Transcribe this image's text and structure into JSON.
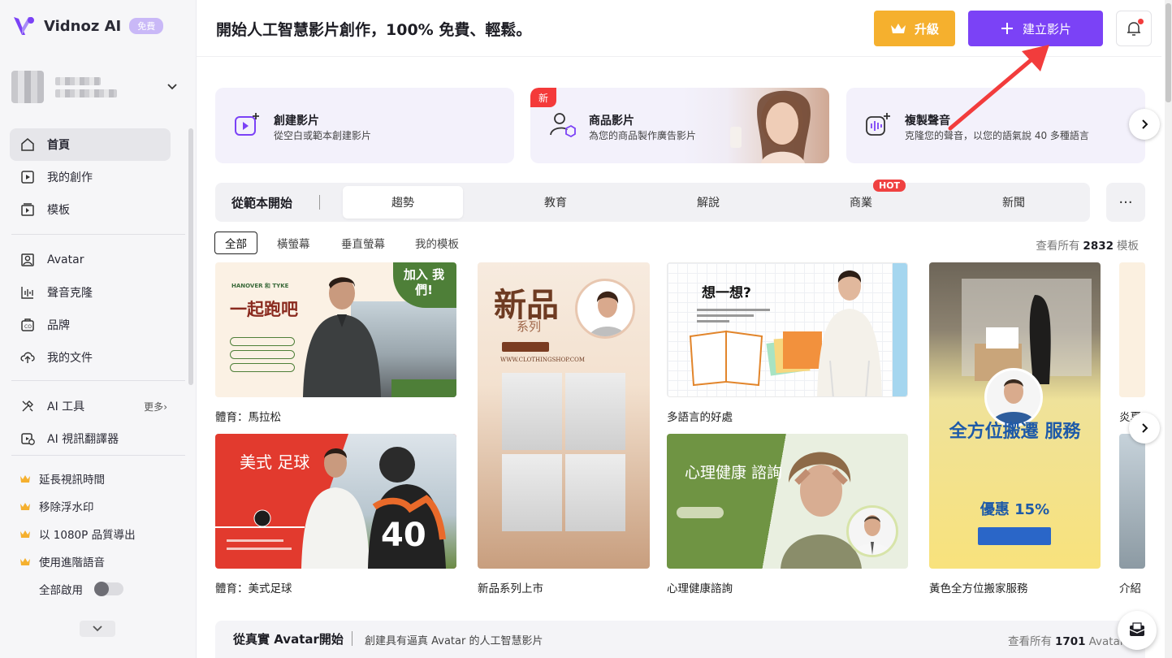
{
  "brand": {
    "name": "Vidnoz AI",
    "badge": "免費"
  },
  "sidebar": {
    "main_items": [
      {
        "label": "首頁",
        "icon": "home-icon",
        "active": true
      },
      {
        "label": "我的創作",
        "icon": "play-square-icon"
      },
      {
        "label": "模板",
        "icon": "template-icon"
      }
    ],
    "tool_items": [
      {
        "label": "Avatar",
        "icon": "avatar-icon"
      },
      {
        "label": "聲音克隆",
        "icon": "waveform-icon"
      },
      {
        "label": "品牌",
        "icon": "brand-icon"
      },
      {
        "label": "我的文件",
        "icon": "upload-cloud-icon"
      }
    ],
    "ai_items": [
      {
        "label": "AI 工具",
        "icon": "tools-icon",
        "more": "更多"
      },
      {
        "label": "AI 視訊翻譯器",
        "icon": "translate-icon"
      }
    ],
    "pro_items": [
      {
        "label": "延長視訊時間"
      },
      {
        "label": "移除浮水印"
      },
      {
        "label": "以 1080P 品質導出"
      },
      {
        "label": "使用進階語音"
      }
    ],
    "enable_all": "全部啟用",
    "enable_all_on": false
  },
  "header": {
    "title": "開始人工智慧影片創作，100% 免費、輕鬆。",
    "upgrade_label": "升級",
    "create_label": "建立影片"
  },
  "features": [
    {
      "title": "創建影片",
      "subtitle": "從空白或範本創建影片",
      "icon": "video-plus-icon"
    },
    {
      "title": "商品影片",
      "subtitle": "為您的商品製作廣告影片",
      "icon": "product-avatar-icon",
      "badge": "新"
    },
    {
      "title": "複製聲音",
      "subtitle": "克隆您的聲音，以您的語氣說 40 多種語言",
      "icon": "voice-clone-icon"
    }
  ],
  "templates_section": {
    "label": "從範本開始",
    "tabs": [
      "趨勢",
      "教育",
      "解說",
      "商業",
      "新聞"
    ],
    "active_tab": 0,
    "hot_badge": "HOT",
    "more": "···",
    "filters": [
      "全部",
      "橫螢幕",
      "垂直螢幕",
      "我的模板"
    ],
    "active_filter": 0,
    "view_all_prefix": "查看所有",
    "view_all_count": "2832",
    "view_all_suffix": "模板"
  },
  "templates": [
    {
      "caption": "體育：馬拉松",
      "thumb_title": "一起跑吧",
      "thumb_badge": "加入 我們!",
      "thumb_brand": "HANOVER 和 TYKE"
    },
    {
      "caption": "新品系列上市",
      "thumb_title": "新品",
      "thumb_sub": "系列",
      "thumb_url": "WWW.CLOTHINGSHOP.COM"
    },
    {
      "caption": "多語言的好處",
      "thumb_title": "想一想?"
    },
    {
      "caption": "黃色全方位搬家服務",
      "thumb_title": "全方位搬遷 服務",
      "thumb_deal": "優惠 15%"
    },
    {
      "caption": "體育：美式足球",
      "thumb_title": "美式 足球"
    },
    {
      "caption": "心理健康諮詢",
      "thumb_title": "心理健康 諮詢"
    },
    {
      "caption": "炎夏"
    },
    {
      "caption": "介紹"
    }
  ],
  "avatar_section": {
    "title": "從真實 Avatar開始",
    "subtitle": "創建具有逼真 Avatar 的人工智慧影片",
    "view_all_prefix": "查看所有",
    "view_all_count": "1701",
    "view_all_suffix": "Avatar"
  },
  "colors": {
    "accent": "#7b42f6",
    "upgrade": "#f5b02e",
    "hot": "#f04141",
    "arrow": "#f23c3c"
  }
}
